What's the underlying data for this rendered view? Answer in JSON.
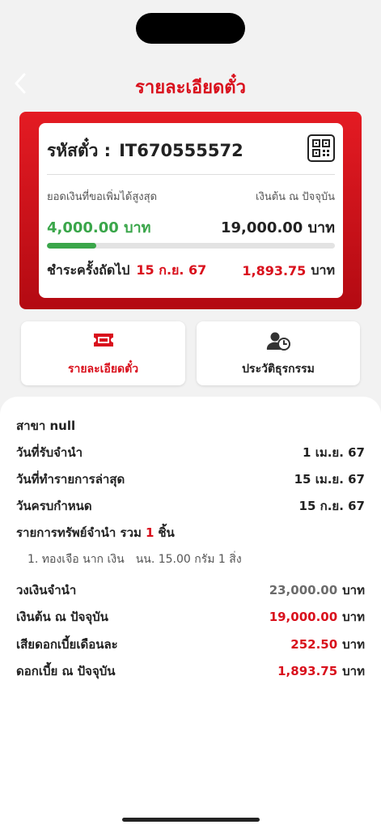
{
  "header": {
    "title": "รายละเอียดตั๋ว"
  },
  "ticket": {
    "id_label": "รหัสตั๋ว :",
    "id_value": "IT670555572",
    "max_label": "ยอดเงินที่ขอเพิ่มได้สูงสุด",
    "principal_label": "เงินต้น ณ ปัจจุบัน",
    "max_value": "4,000.00 บาท",
    "principal_value": "19,000.00 บาท",
    "progress_fraction": 0.17,
    "next_payment_label": "ชำระครั้งถัดไป",
    "next_payment_date": "15 ก.ย. 67",
    "next_payment_amount": "1,893.75",
    "next_payment_unit": "บาท"
  },
  "actions": {
    "details_label": "รายละเอียดตั๋ว",
    "history_label": "ประวัติธุรกรรม"
  },
  "details": {
    "branch": "สาขา null",
    "pawn_date_label": "วันที่รับจำนำ",
    "pawn_date_value": "1 เม.ย. 67",
    "last_tx_label": "วันที่ทำรายการล่าสุด",
    "last_tx_value": "15 เม.ย. 67",
    "due_label": "วันครบกำหนด",
    "due_value": "15 ก.ย. 67",
    "assets_prefix": "รายการทรัพย์จำนำ รวม",
    "assets_count": "1",
    "assets_suffix": "ชิ้น",
    "asset_item_index": "1. ทองเจือ นาก เงิน",
    "asset_item_desc": "นน. 15.00 กรัม 1 สิ่ง",
    "credit_label": "วงเงินจำนำ",
    "credit_value": "23,000.00",
    "principal_label": "เงินต้น ณ ปัจจุบัน",
    "principal_value": "19,000.00",
    "monthly_interest_label": "เสียดอกเบี้ยเดือนละ",
    "monthly_interest_value": "252.50",
    "current_interest_label": "ดอกเบี้ย ณ ปัจจุบัน",
    "current_interest_value": "1,893.75",
    "unit": "บาท"
  },
  "colors": {
    "accent_red": "#d9101c",
    "green": "#3aa64a"
  },
  "icons": {
    "back": "chevron-left-icon",
    "qr": "qr-code-icon",
    "ticket": "ticket-icon",
    "history": "user-clock-icon"
  }
}
